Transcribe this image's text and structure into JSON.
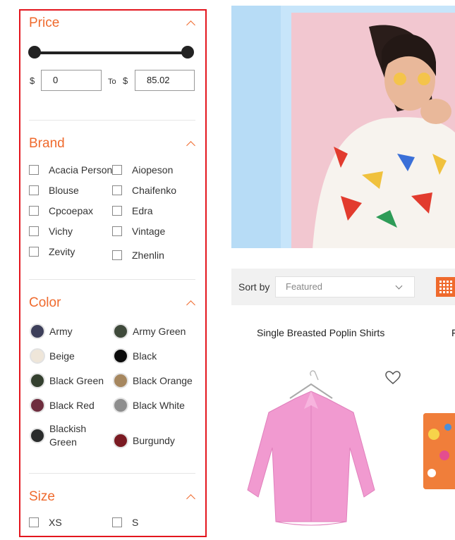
{
  "filters": {
    "price": {
      "title": "Price",
      "currency": "$",
      "min_value": "0",
      "max_value": "85.02",
      "to_label": "To",
      "slider_range": [
        0,
        1
      ]
    },
    "brand": {
      "title": "Brand",
      "items": [
        "Acacia Person",
        "Aiopeson",
        "Blouse",
        "Chaifenko",
        "Cpcoepax",
        "Edra",
        "Vichy",
        "Vintage",
        "Zevity",
        "Zhenlin"
      ]
    },
    "color": {
      "title": "Color",
      "items": [
        {
          "label": "Army",
          "hex": "#3d3f5a"
        },
        {
          "label": "Army Green",
          "hex": "#3f4a3b"
        },
        {
          "label": "Beige",
          "hex": "#efe6d9"
        },
        {
          "label": "Black",
          "hex": "#0b0b0b"
        },
        {
          "label": "Black Green",
          "hex": "#34402f"
        },
        {
          "label": "Black Orange",
          "hex": "#a6875f"
        },
        {
          "label": "Black Red",
          "hex": "#6e2d3e"
        },
        {
          "label": "Black White",
          "hex": "#8e8e8e"
        },
        {
          "label": "Blackish Green",
          "hex": "#2a2c2c"
        },
        {
          "label": "Burgundy",
          "hex": "#7a1a22"
        }
      ]
    },
    "size": {
      "title": "Size",
      "items": [
        "XS",
        "S"
      ]
    }
  },
  "toolbar": {
    "sort_label": "Sort by",
    "sort_value": "Featured"
  },
  "products": [
    {
      "title": "Single Breasted Poplin Shirts"
    },
    {
      "title": "F"
    }
  ],
  "colors": {
    "accent": "#ef6a2d",
    "highlight_border": "#e3161e",
    "sortbar_bg": "#f1f1f1"
  }
}
